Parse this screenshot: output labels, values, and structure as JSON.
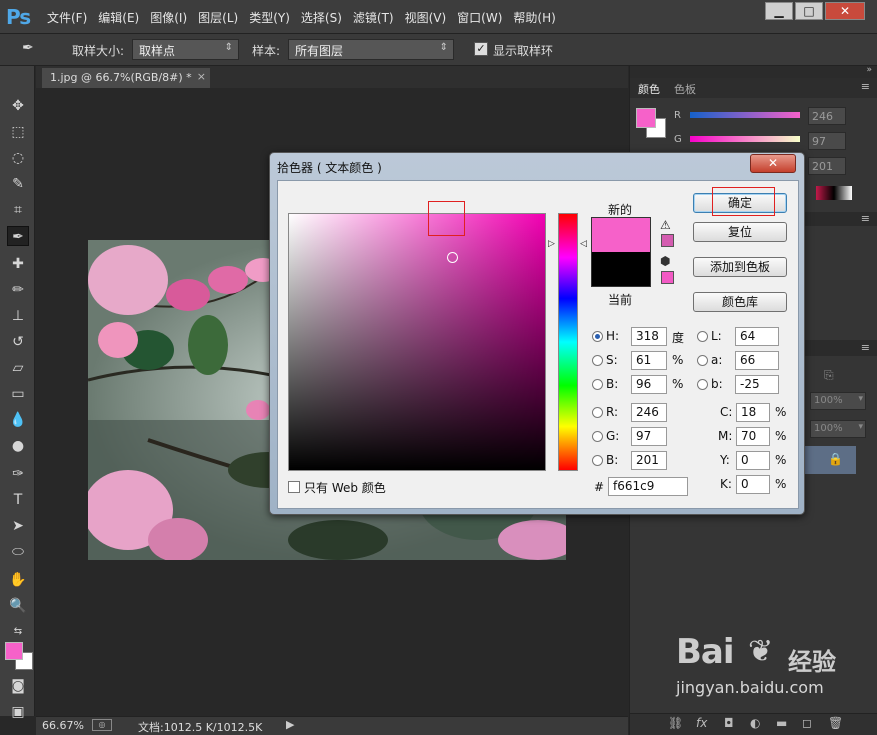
{
  "app": {
    "logo": "Ps",
    "menu": [
      "文件(F)",
      "编辑(E)",
      "图像(I)",
      "图层(L)",
      "类型(Y)",
      "选择(S)",
      "滤镜(T)",
      "视图(V)",
      "窗口(W)",
      "帮助(H)"
    ],
    "window_controls": {
      "minimize": "▁",
      "maximize": "□",
      "close": "✕"
    }
  },
  "options_bar": {
    "sample_size_label": "取样大小:",
    "sample_size_value": "取样点",
    "sample_label": "样本:",
    "sample_value": "所有图层",
    "show_ring_label": "显示取样环",
    "show_ring_checked": true
  },
  "document": {
    "tab_title": "1.jpg @ 66.7%(RGB/8#) *",
    "tab_close": "×"
  },
  "status_bar": {
    "zoom": "66.67%",
    "doc_size": "文档:1012.5 K/1012.5K"
  },
  "color_panel": {
    "tabs": [
      "颜色",
      "色板"
    ],
    "sliders": [
      {
        "label": "R",
        "value": "246"
      },
      {
        "label": "G",
        "value": "97"
      },
      {
        "label": "",
        "value": "201"
      }
    ],
    "opacity_values": [
      "100%",
      "100%"
    ]
  },
  "dialog": {
    "title": "拾色器 ( 文本颜色 )",
    "close": "✕",
    "new_label": "新的",
    "current_label": "当前",
    "new_color": "#f661c9",
    "current_color": "#000000",
    "buttons": {
      "ok": "确定",
      "reset": "复位",
      "add_to_swatches": "添加到色板",
      "color_libraries": "颜色库"
    },
    "web_only_label": "只有 Web 颜色",
    "hsb": {
      "h": "318",
      "s": "61",
      "b": "96",
      "h_unit": "度",
      "s_unit": "%",
      "b_unit": "%",
      "h_label": "H:",
      "s_label": "S:",
      "b_label": "B:"
    },
    "rgb": {
      "r": "246",
      "g": "97",
      "b": "201",
      "r_label": "R:",
      "g_label": "G:",
      "b_label": "B:"
    },
    "lab": {
      "l": "64",
      "a": "66",
      "b": "-25",
      "l_label": "L:",
      "a_label": "a:",
      "b_label": "b:"
    },
    "cmyk": {
      "c": "18",
      "m": "70",
      "y": "0",
      "k": "0",
      "c_label": "C:",
      "m_label": "M:",
      "y_label": "Y:",
      "k_label": "K:",
      "unit": "%"
    },
    "hex_label": "#",
    "hex": "f661c9"
  },
  "watermark": {
    "brand": "Bai",
    "brand2": "经验",
    "url": "jingyan.baidu.com"
  }
}
